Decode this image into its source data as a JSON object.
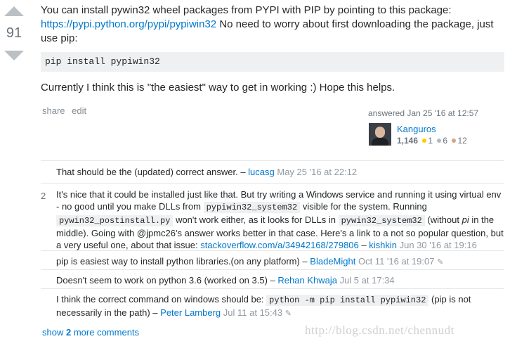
{
  "answer": {
    "vote_count": "91",
    "body_text_1": "You can install pywin32 wheel packages from PYPI with PIP by pointing to this package:",
    "body_link": "https://pypi.python.org/pypi/pypiwin32",
    "body_text_2": "No need to worry about first downloading the package, just use pip:",
    "code_block": "pip install pypiwin32",
    "body_para2": "Currently I think this is \"the easiest\" way to get in working :) Hope this helps.",
    "menu": {
      "share": "share",
      "edit": "edit"
    },
    "signature": {
      "action": "answered Jan 25 '16 at 12:57",
      "user": "Kanguros",
      "reputation": "1,146",
      "gold": "1",
      "silver": "6",
      "bronze": "12"
    }
  },
  "comments": [
    {
      "score": "",
      "parts": {
        "text": "That should be the (updated) correct answer. –",
        "user": "lucasg",
        "date": "May 25 '16 at 22:12"
      }
    },
    {
      "score": "2",
      "parts": {
        "t1": "It's nice that it could be installed just like that. But try writing a Windows service and running it using virtual env - no good until you make DLLs from",
        "c1": "pypiwin32_system32",
        "t2": "visible for the system. Running",
        "c2": "pywin32_postinstall.py",
        "t3": "won't work either, as it looks for DLLs in",
        "c3": "pywin32_system32",
        "t4": "(without",
        "t4i": "pi",
        "t5": "in the middle). Going with @jpmc26's answer works better in that case. Here's a link to a not so popular question, but a very useful one, about that issue:",
        "link": "stackoverflow.com/a/34942168/279806",
        "dash": "–",
        "user": "kishkin",
        "date": "Jun 30 '16 at 19:16"
      }
    },
    {
      "score": "",
      "parts": {
        "text": "pip is easiest way to install python libraries.(on any platform) –",
        "user": "BladeMight",
        "date": "Oct 11 '16 at 19:07"
      }
    },
    {
      "score": "",
      "parts": {
        "text": "Doesn't seem to work on python 3.6 (worked on 3.5) –",
        "user": "Rehan Khwaja",
        "date": "Jul 5 at 17:34"
      }
    },
    {
      "score": "",
      "parts": {
        "t1": "I think the correct command on windows should be:",
        "c1": "python -m pip install pypiwin32",
        "t2": "(pip is not necessarily in the path) –",
        "user": "Peter Lamberg",
        "date": "Jul 11 at 15:43"
      }
    }
  ],
  "more_comments": {
    "prefix": "show",
    "count": "2",
    "suffix": "more comments"
  },
  "watermark": "http://blog.csdn.net/chennudt"
}
